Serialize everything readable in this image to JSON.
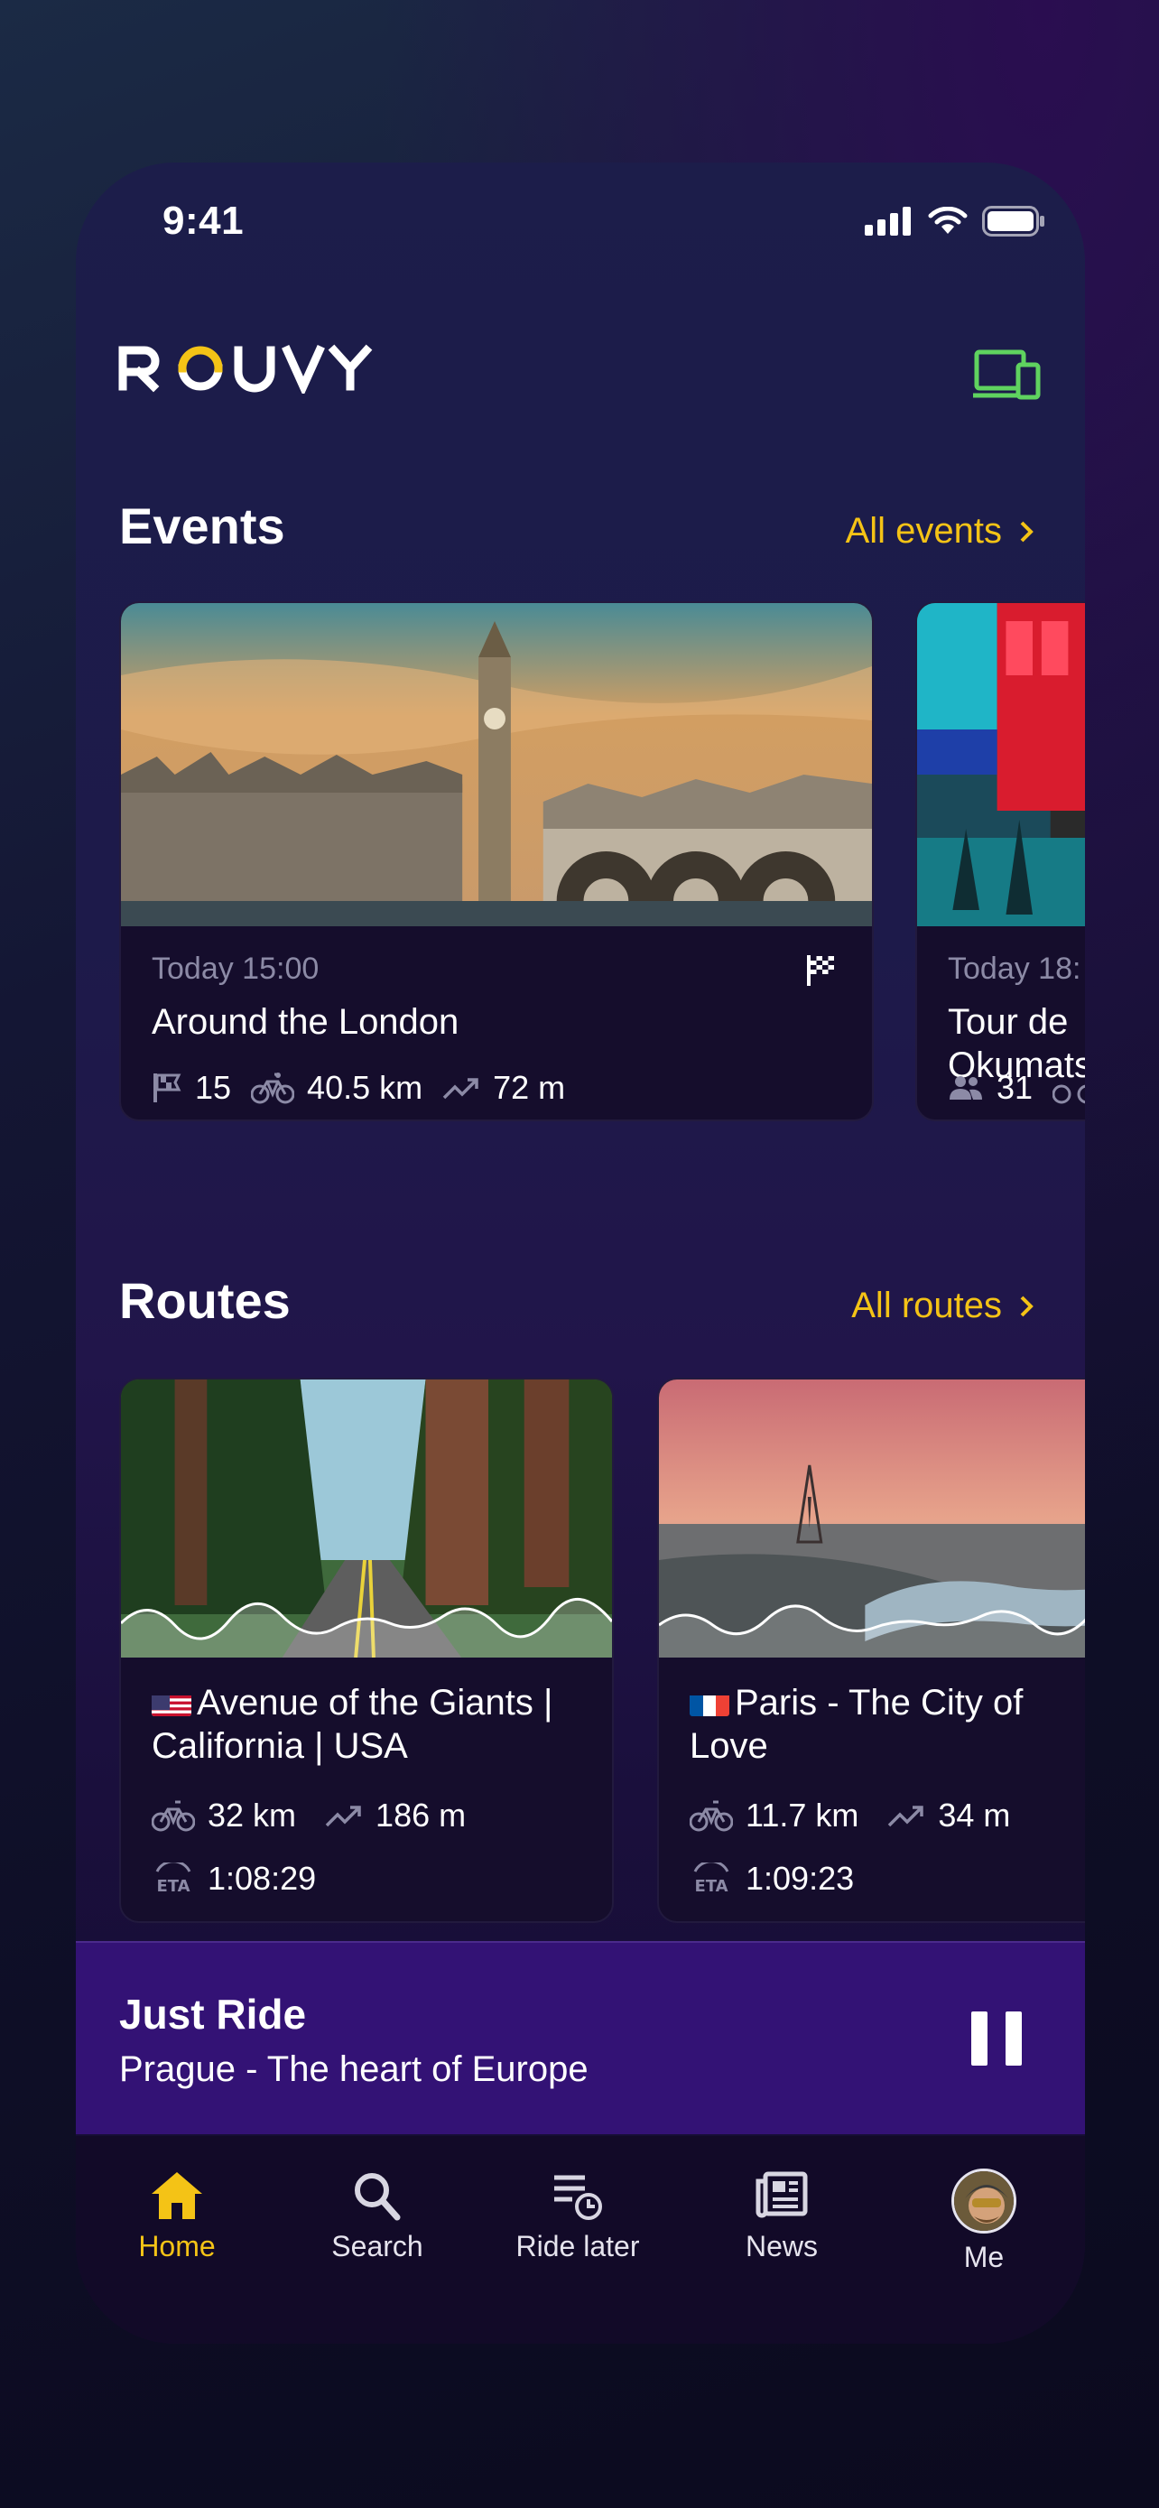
{
  "status_bar": {
    "time": "9:41"
  },
  "header": {
    "logo_text": "ROUVY"
  },
  "events": {
    "title": "Events",
    "link_label": "All events",
    "cards": [
      {
        "time": "Today 15:00",
        "title": "Around the London",
        "participants": "15",
        "distance": "40.5 km",
        "elevation": "72 m"
      },
      {
        "time": "Today 18:",
        "title_line1": "Tour de",
        "title_line2": "Okumats",
        "participants": "31"
      }
    ]
  },
  "routes": {
    "title": "Routes",
    "link_label": "All routes",
    "cards": [
      {
        "title": "Avenue of the Giants | California | USA",
        "distance": "32 km",
        "elevation": "186 m",
        "eta": "1:08:29"
      },
      {
        "title": "Paris - The City of Love",
        "distance": "11.7 km",
        "elevation": "34 m",
        "eta": "1:09:23"
      }
    ]
  },
  "just_ride": {
    "title": "Just Ride",
    "subtitle": "Prague - The heart of Europe"
  },
  "tabbar": {
    "items": [
      {
        "label": "Home",
        "icon": "home-icon",
        "active": true
      },
      {
        "label": "Search",
        "icon": "search-icon"
      },
      {
        "label": "Ride later",
        "icon": "ride-later-icon"
      },
      {
        "label": "News",
        "icon": "news-icon"
      },
      {
        "label": "Me",
        "icon": "avatar"
      }
    ]
  },
  "colors": {
    "accent": "#f4c316",
    "card_bg": "#150d2c",
    "just_ride_bg": "#331275",
    "device_icon": "#5fd35f"
  }
}
